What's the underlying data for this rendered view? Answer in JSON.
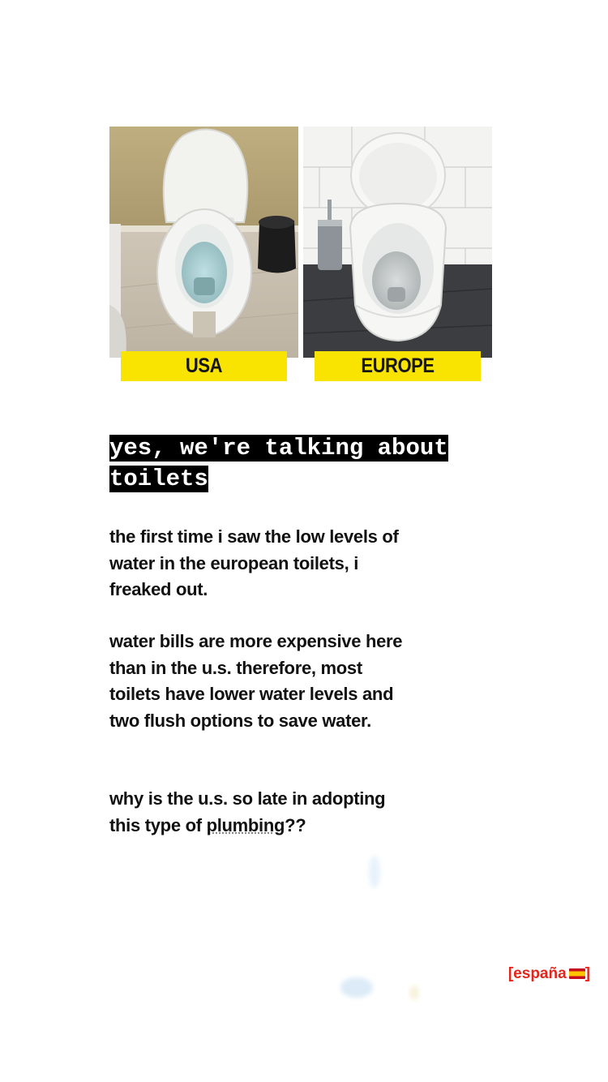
{
  "comparison": {
    "left_label": "USA",
    "right_label": "EUROPE",
    "highlight_color": "#f9e300"
  },
  "headline": "yes, we're talking about toilets",
  "paragraphs": [
    "the first time i saw the low levels of water in the european toilets, i freaked out.",
    "water bills are more expensive here than in the u.s.  therefore, most toilets have lower water levels and two flush options to save water.",
    "why is the u.s. so late in adopting this type of"
  ],
  "underlined_word": "plumbing",
  "paragraph3_suffix": "??",
  "location_tag": {
    "open": "[españa",
    "close": "]",
    "color": "#e2261c",
    "flag_icon": "spain-flag-icon"
  }
}
